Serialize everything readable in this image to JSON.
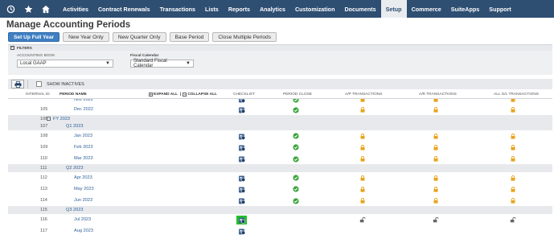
{
  "topnav": {
    "icons": [
      "history-icon",
      "star-icon",
      "home-icon"
    ],
    "items": [
      "Activities",
      "Contract Renewals",
      "Transactions",
      "Lists",
      "Reports",
      "Analytics",
      "Customization",
      "Documents",
      "Setup",
      "Commerce",
      "SuiteApps",
      "Support"
    ],
    "active": "Setup",
    "bg_color": "#2e4e72"
  },
  "page_title": "Manage Accounting Periods",
  "buttons": [
    "Set Up Full Year",
    "New Year Only",
    "New Quarter Only",
    "Base Period",
    "Close Multiple Periods"
  ],
  "filters": {
    "title": "FILTERS",
    "accounting_book_label": "ACCOUNTING BOOK",
    "accounting_book_value": "Local GAAP",
    "fiscal_calendar_label": "Fiscal Calendar",
    "fiscal_calendar_value": "Standard Fiscal Calendar"
  },
  "toolbar": {
    "print_icon": "printer-icon",
    "show_inactives_label": "SHOW INACTIVES",
    "show_inactives_checked": false
  },
  "table": {
    "headers": {
      "internal_id": "INTERNAL ID",
      "period_name": "PERIOD NAME",
      "expand_all": "EXPAND ALL",
      "collapse_all": "COLLAPSE ALL",
      "checklist": "CHECKLIST",
      "period_close": "PERIOD CLOSE",
      "ap": "A/P TRANSACTIONS",
      "ar": "A/R TRANSACTIONS",
      "all_gl": "ALL G/L TRANSACTIONS"
    },
    "rows": [
      {
        "kind": "partial",
        "id": "",
        "name": "Nov 2022",
        "checklist": true,
        "close": "check",
        "ap": "lock",
        "ar": "lock",
        "gl": "lock"
      },
      {
        "kind": "period",
        "id": "105",
        "name": "Dec 2022",
        "checklist": true,
        "close": "check",
        "ap": "lock",
        "ar": "lock",
        "gl": "lock"
      },
      {
        "kind": "year",
        "id": "106",
        "name": "FY 2023",
        "expander": "−"
      },
      {
        "kind": "quarter",
        "id": "107",
        "name": "Q1 2023"
      },
      {
        "kind": "period",
        "id": "108",
        "name": "Jan 2023",
        "checklist": true,
        "close": "check",
        "ap": "lock",
        "ar": "lock",
        "gl": "lock"
      },
      {
        "kind": "period",
        "id": "109",
        "name": "Feb 2023",
        "checklist": true,
        "close": "check",
        "ap": "lock",
        "ar": "lock",
        "gl": "lock"
      },
      {
        "kind": "period",
        "id": "110",
        "name": "Mar 2023",
        "checklist": true,
        "close": "check",
        "ap": "lock",
        "ar": "lock",
        "gl": "lock"
      },
      {
        "kind": "quarter",
        "id": "111",
        "name": "Q2 2023"
      },
      {
        "kind": "period",
        "id": "112",
        "name": "Apr 2023",
        "checklist": true,
        "close": "check",
        "ap": "lock",
        "ar": "lock",
        "gl": "lock"
      },
      {
        "kind": "period",
        "id": "113",
        "name": "May 2023",
        "checklist": true,
        "close": "check",
        "ap": "lock",
        "ar": "lock",
        "gl": "lock"
      },
      {
        "kind": "period",
        "id": "114",
        "name": "Jun 2023",
        "checklist": true,
        "close": "check",
        "ap": "lock",
        "ar": "lock",
        "gl": "lock"
      },
      {
        "kind": "quarter",
        "id": "115",
        "name": "Q3 2023"
      },
      {
        "kind": "period",
        "id": "116",
        "name": "Jul 2023",
        "checklist": true,
        "checklist_highlight": true,
        "close": "",
        "ap": "unlock",
        "ar": "unlock",
        "gl": "unlock"
      },
      {
        "kind": "period",
        "id": "117",
        "name": "Aug 2023",
        "checklist": true,
        "close": "",
        "ap": "",
        "ar": "",
        "gl": ""
      }
    ]
  },
  "colors": {
    "primary_button": "#3f7fc2",
    "link": "#2f5f9a",
    "lock": "#e8a31a",
    "check": "#3aa43a",
    "highlight": "#22c12a"
  }
}
